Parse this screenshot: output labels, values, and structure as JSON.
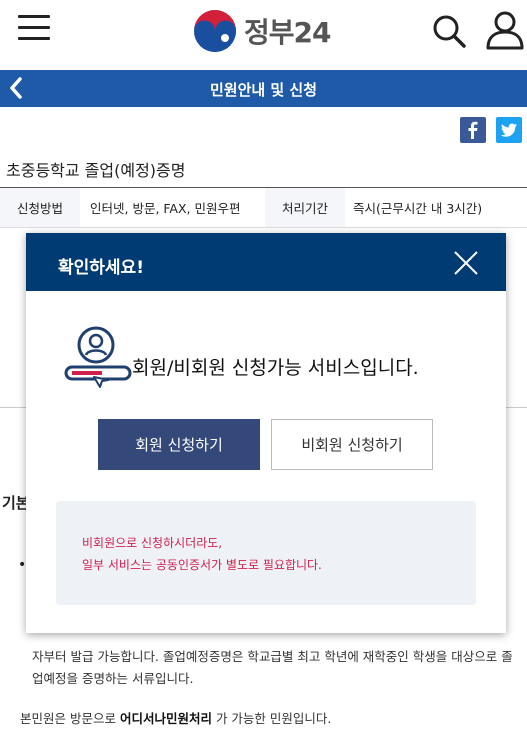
{
  "header": {
    "logo_text": "정부24",
    "menu_icon": "hamburger-menu-icon",
    "search_icon": "search-icon",
    "user_icon": "user-icon"
  },
  "titlebar": {
    "title": "민원안내 및 신청",
    "back_icon": "chevron-left-icon"
  },
  "share": {
    "facebook_icon": "facebook-icon",
    "twitter_icon": "twitter-icon"
  },
  "service": {
    "title": "초중등학교 졸업(예정)증명",
    "table": {
      "method_label": "신청방법",
      "method_value": "인터넷, 방문, FAX, 민원우편",
      "period_label": "처리기간",
      "period_value": "즉시(근무시간 내 3시간)"
    },
    "basic_label": "기본",
    "bullet": "•",
    "para": "자부터 발급 가능합니다. 졸업예정증명은 학교급별 최고 학년에 재학중인 학생을 대상으로 졸업예정을 증명하는 서류입니다.",
    "note_prefix": "본민원은 방문으로",
    "note_bold": "어디서나민원처리",
    "note_suffix": " 가 가능한 민원입니다."
  },
  "modal": {
    "title": "확인하세요!",
    "close_icon": "close-icon",
    "message_icon": "member-card-icon",
    "message": "회원/비회원 신청가능 서비스입니다.",
    "member_button": "회원 신청하기",
    "guest_button": "비회원 신청하기",
    "notice_line1": "비회원으로 신청하시더라도,",
    "notice_line2": "일부 서비스는 공동인증서가 별도로 필요합니다."
  },
  "colors": {
    "titlebar": "#1e5aa8",
    "modal_header": "#003b73",
    "member_button": "#34497a",
    "notice_text": "#d0204d",
    "notice_bg": "#eef2f7"
  }
}
